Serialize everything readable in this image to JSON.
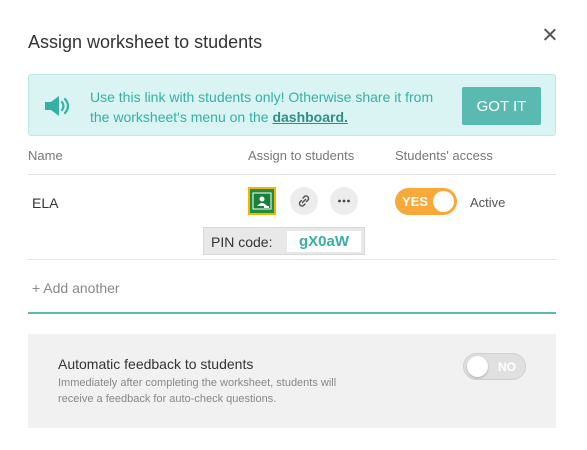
{
  "dialog": {
    "title": "Assign worksheet to students",
    "close_icon": "close-icon"
  },
  "banner": {
    "message": "Use this link with students only! Otherwise share it from the worksheet's menu on the",
    "link_text": "dashboard.",
    "button_label": "GOT IT",
    "icon": "speaker-icon"
  },
  "table": {
    "headers": {
      "name": "Name",
      "assign": "Assign to students",
      "access": "Students' access"
    },
    "row": {
      "name": "ELA",
      "icons": [
        "google-classroom-icon",
        "link-icon",
        "more-icon"
      ],
      "toggle_label": "YES",
      "status": "Active",
      "pin_label": "PIN code:",
      "pin_code": "gX0aW"
    },
    "add_another": "+ Add another"
  },
  "feedback": {
    "title": "Automatic feedback to students",
    "description": "Immediately after completing the worksheet, students will receive a feedback for auto-check questions.",
    "toggle_label": "NO"
  },
  "colors": {
    "accent": "#5ab9b1",
    "toggle_on": "#f9a83a",
    "banner_bg": "#d9f4f2"
  }
}
